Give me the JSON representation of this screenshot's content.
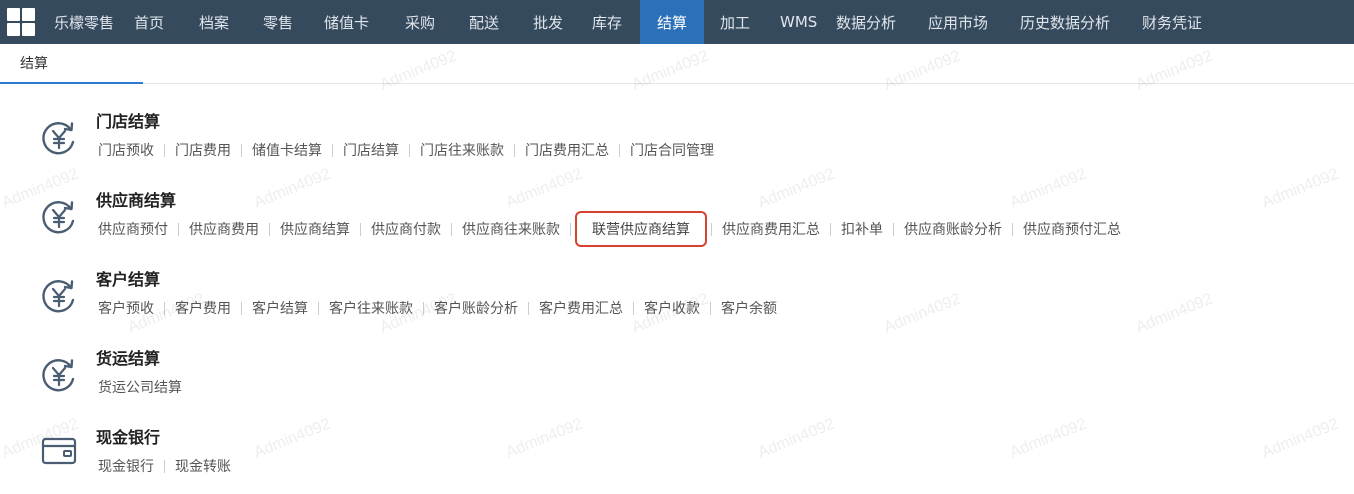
{
  "nav": {
    "items": [
      "乐檬零售",
      "首页",
      "档案",
      "零售",
      "储值卡",
      "采购",
      "配送",
      "批发",
      "库存",
      "结算",
      "加工",
      "WMS",
      "数据分析",
      "应用市场",
      "历史数据分析",
      "财务凭证"
    ],
    "active_index": 9
  },
  "tab": {
    "label": "结算"
  },
  "sections": [
    {
      "title": "门店结算",
      "icon": "yen-cycle-icon",
      "links": [
        "门店预收",
        "门店费用",
        "储值卡结算",
        "门店结算",
        "门店往来账款",
        "门店费用汇总",
        "门店合同管理"
      ]
    },
    {
      "title": "供应商结算",
      "icon": "yen-cycle-icon",
      "links": [
        "供应商预付",
        "供应商费用",
        "供应商结算",
        "供应商付款",
        "供应商往来账款",
        "联营供应商结算",
        "供应商费用汇总",
        "扣补单",
        "供应商账龄分析",
        "供应商预付汇总"
      ],
      "highlighted": "联营供应商结算"
    },
    {
      "title": "客户结算",
      "icon": "yen-cycle-icon",
      "links": [
        "客户预收",
        "客户费用",
        "客户结算",
        "客户往来账款",
        "客户账龄分析",
        "客户费用汇总",
        "客户收款",
        "客户余额"
      ]
    },
    {
      "title": "货运结算",
      "icon": "yen-cycle-icon",
      "links": [
        "货运公司结算"
      ]
    },
    {
      "title": "现金银行",
      "icon": "wallet-card-icon",
      "links": [
        "现金银行",
        "现金转账"
      ]
    }
  ],
  "watermark": "Admin4092",
  "colors": {
    "topbar": "#364a5e",
    "active": "#2b70b8",
    "highlight_border": "#d9412f",
    "icon": "#4a5d73"
  }
}
